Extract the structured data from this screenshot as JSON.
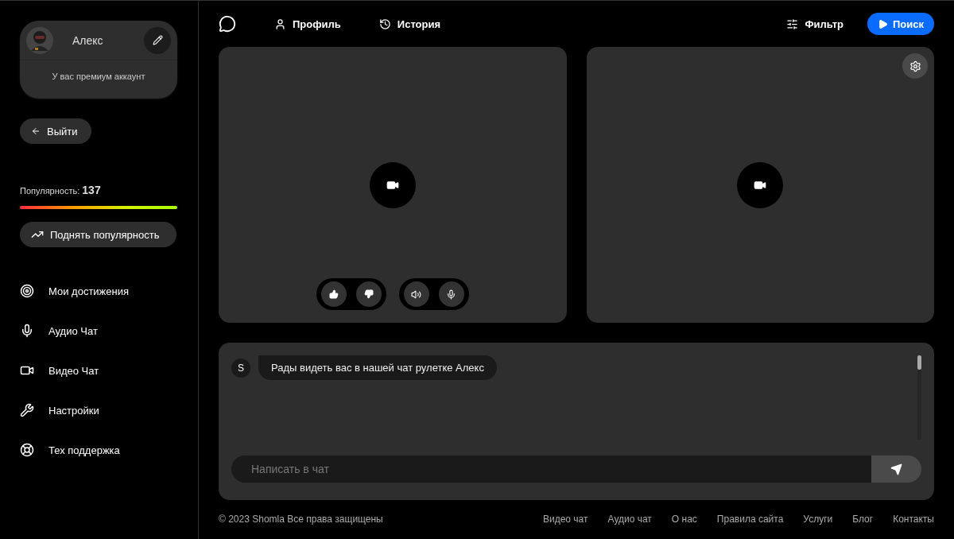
{
  "profile": {
    "name": "Алекс",
    "status": "У вас премиум аккаунт"
  },
  "logout": {
    "label": "Выйти"
  },
  "popularity": {
    "label": "Популярность:",
    "value": "137",
    "level": 1
  },
  "boost": {
    "label": "Поднять популярность"
  },
  "sidebar": {
    "items": [
      {
        "kind": "target",
        "label": "Мои достижения"
      },
      {
        "kind": "mic",
        "label": "Аудио Чат"
      },
      {
        "kind": "video",
        "label": "Видео Чат"
      },
      {
        "kind": "wrench",
        "label": "Настройки"
      },
      {
        "kind": "support",
        "label": "Тех поддержка"
      }
    ]
  },
  "topnav": {
    "links": [
      {
        "kind": "user",
        "label": "Профиль"
      },
      {
        "kind": "history",
        "label": "История"
      }
    ],
    "filter": "Фильтр",
    "search": "Поиск"
  },
  "chat": {
    "messages": [
      {
        "sender": "S",
        "text": "Рады видеть вас в нашей чат рулетке Алекс"
      }
    ],
    "input": {
      "placeholder": "Написать в чат"
    }
  },
  "footer": {
    "copyright": "© 2023 Shomla Все права защищены",
    "links": [
      "Видео чат",
      "Аудио чат",
      "О нас",
      "Правила сайта",
      "Услуги",
      "Блог",
      "Контакты"
    ]
  }
}
